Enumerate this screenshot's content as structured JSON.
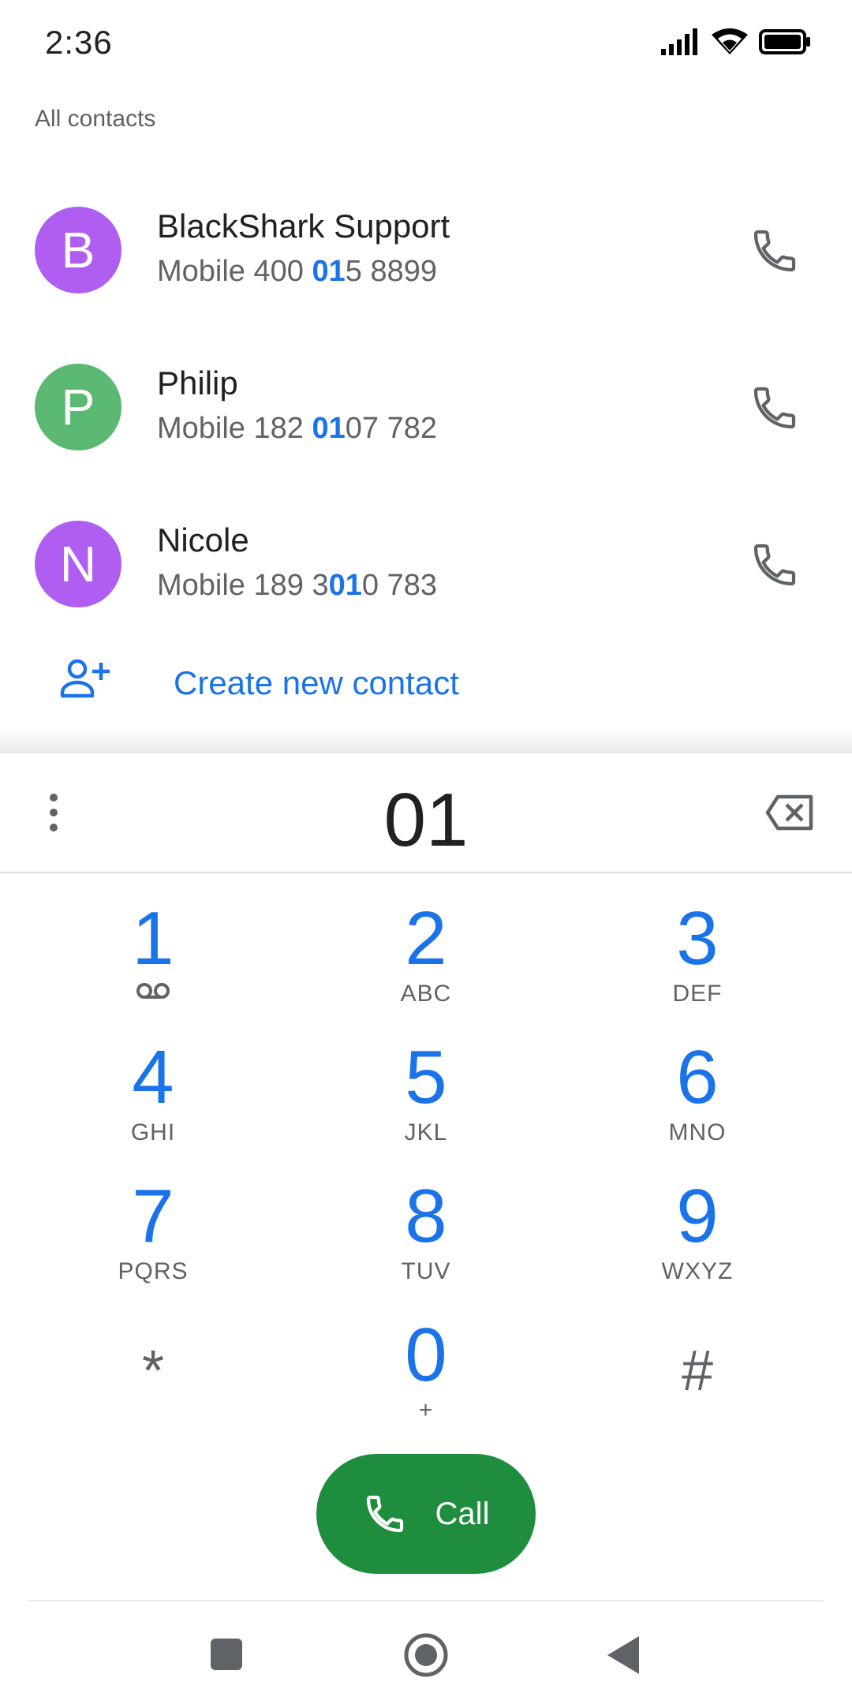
{
  "status_bar": {
    "time": "2:36"
  },
  "section_label": "All contacts",
  "contacts": [
    {
      "initial": "B",
      "name": "BlackShark Support",
      "number_prefix": "Mobile 400 ",
      "number_match": "01",
      "number_suffix": "5 8899",
      "avatar_color": "#b05ef2"
    },
    {
      "initial": "P",
      "name": "Philip",
      "number_prefix": "Mobile 182 ",
      "number_match": "01",
      "number_suffix": "07 782",
      "avatar_color": "#5bb974"
    },
    {
      "initial": "N",
      "name": "Nicole",
      "number_prefix": "Mobile 189 3",
      "number_match": "01",
      "number_suffix": "0 783",
      "avatar_color": "#b05ef2"
    }
  ],
  "create_contact_label": "Create new contact",
  "dialer": {
    "digits": "01",
    "keys": [
      {
        "digit": "1",
        "letters": ""
      },
      {
        "digit": "2",
        "letters": "ABC"
      },
      {
        "digit": "3",
        "letters": "DEF"
      },
      {
        "digit": "4",
        "letters": "GHI"
      },
      {
        "digit": "5",
        "letters": "JKL"
      },
      {
        "digit": "6",
        "letters": "MNO"
      },
      {
        "digit": "7",
        "letters": "PQRS"
      },
      {
        "digit": "8",
        "letters": "TUV"
      },
      {
        "digit": "9",
        "letters": "WXYZ"
      },
      {
        "digit": "*",
        "letters": ""
      },
      {
        "digit": "0",
        "letters": "+"
      },
      {
        "digit": "#",
        "letters": ""
      }
    ],
    "call_label": "Call"
  },
  "colors": {
    "accent": "#1a73e8",
    "call_green": "#1e8e3e"
  }
}
